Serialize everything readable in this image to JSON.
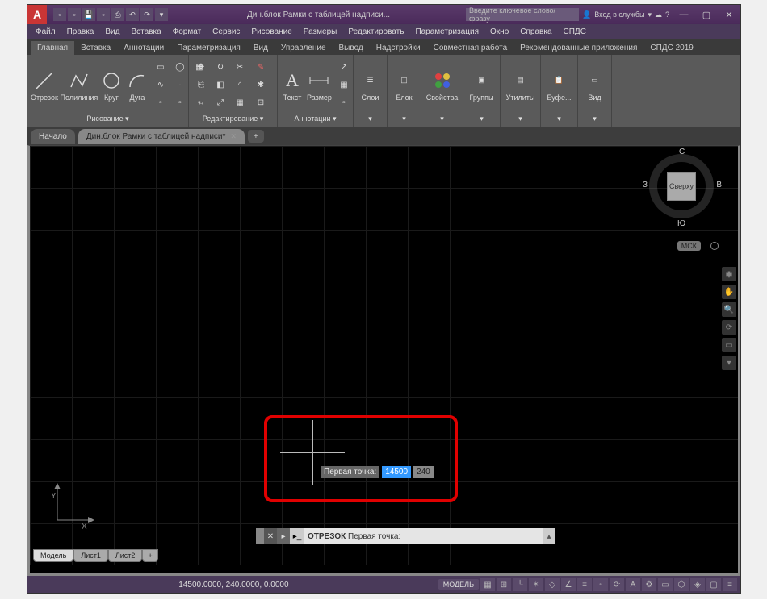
{
  "window": {
    "title": "Дин.блок Рамки с таблицей надписи..."
  },
  "search": {
    "placeholder": "Введите ключевое слово/фразу"
  },
  "login": {
    "label": "Вход в службы"
  },
  "winctrl": {
    "min": "—",
    "max": "▢",
    "close": "✕"
  },
  "menu": [
    "Файл",
    "Правка",
    "Вид",
    "Вставка",
    "Формат",
    "Сервис",
    "Рисование",
    "Размеры",
    "Редактировать",
    "Параметризация",
    "Окно",
    "Справка",
    "СПДС"
  ],
  "ribbon_tabs": [
    "Главная",
    "Вставка",
    "Аннотации",
    "Параметризация",
    "Вид",
    "Управление",
    "Вывод",
    "Надстройки",
    "Совместная работа",
    "Рекомендованные приложения",
    "СПДС 2019"
  ],
  "ribbon": {
    "draw": {
      "title": "Рисование ▾",
      "line": "Отрезок",
      "polyline": "Полилиния",
      "circle": "Круг",
      "arc": "Дуга"
    },
    "modify": {
      "title": "Редактирование ▾"
    },
    "annot": {
      "title": "Аннотации ▾",
      "text": "Текст",
      "dim": "Размер"
    },
    "layers": {
      "title": "Слои"
    },
    "block": {
      "title": "Блок"
    },
    "props": {
      "title": "Свойства"
    },
    "groups": {
      "title": "Группы"
    },
    "utils": {
      "title": "Утилиты"
    },
    "clip": {
      "title": "Буфе..."
    },
    "view": {
      "title": "Вид"
    }
  },
  "doc_tabs": {
    "start": "Начало",
    "active": "Дин.блок Рамки с таблицей надписи*"
  },
  "viewcube": {
    "top": "Сверху",
    "n": "С",
    "s": "Ю",
    "e": "В",
    "w": "З",
    "wcs": "МСК"
  },
  "ucs": {
    "x": "X",
    "y": "Y"
  },
  "dyn": {
    "label": "Первая точка:",
    "v1": "14500",
    "v2": "240"
  },
  "cmd": {
    "name": "ОТРЕЗОК",
    "prompt": "Первая точка:"
  },
  "layouts": [
    "Модель",
    "Лист1",
    "Лист2",
    "+"
  ],
  "status": {
    "coords": "14500.0000, 240.0000, 0.0000",
    "model": "МОДЕЛЬ"
  }
}
